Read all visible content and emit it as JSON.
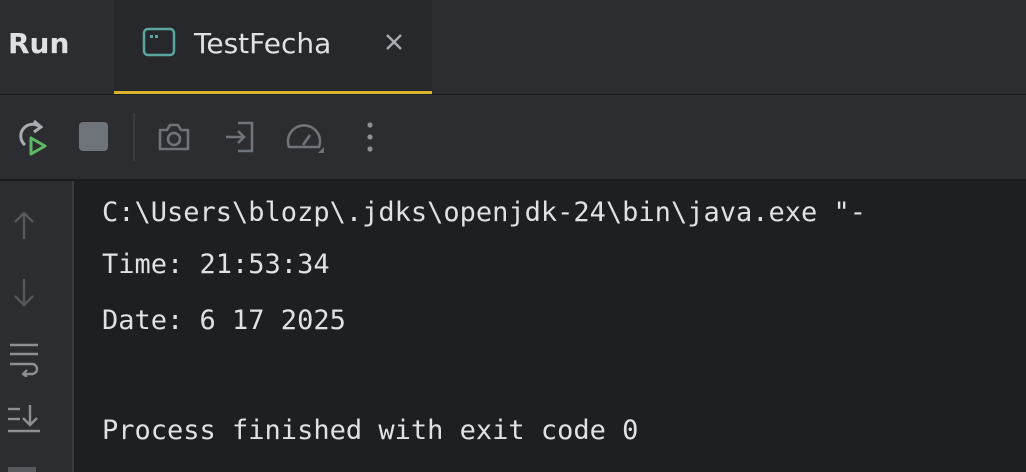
{
  "tabbar": {
    "run_label": "Run",
    "tab": {
      "title": "TestFecha",
      "icon": "terminal-icon",
      "close_icon": "close-icon"
    }
  },
  "toolbar": {
    "buttons": [
      {
        "name": "rerun-button",
        "icon": "rerun-icon"
      },
      {
        "name": "stop-button",
        "icon": "stop-icon"
      },
      {
        "name": "screenshot-button",
        "icon": "camera-icon"
      },
      {
        "name": "restore-layout-button",
        "icon": "exit-icon"
      },
      {
        "name": "profiler-button",
        "icon": "gauge-icon"
      },
      {
        "name": "more-options-button",
        "icon": "more-vertical-icon"
      }
    ]
  },
  "gutter": {
    "buttons": [
      {
        "name": "scroll-up-button",
        "icon": "arrow-up-icon"
      },
      {
        "name": "scroll-down-button",
        "icon": "arrow-down-icon"
      },
      {
        "name": "soft-wrap-button",
        "icon": "soft-wrap-icon"
      },
      {
        "name": "scroll-to-end-button",
        "icon": "scroll-to-end-icon"
      }
    ]
  },
  "console": {
    "lines": [
      "C:\\Users\\blozp\\.jdks\\openjdk-24\\bin\\java.exe \"-",
      "Time: 21:53:34",
      "Date: 6 17 2025",
      "",
      "Process finished with exit code 0"
    ]
  },
  "colors": {
    "background": "#1e1f22",
    "panel": "#2b2d30",
    "text": "#dfe1e5",
    "tab_accent": "#d8b32e",
    "icon_gray": "#8c8f94",
    "run_green": "#5fb865",
    "terminal_teal": "#5aa7a0"
  }
}
